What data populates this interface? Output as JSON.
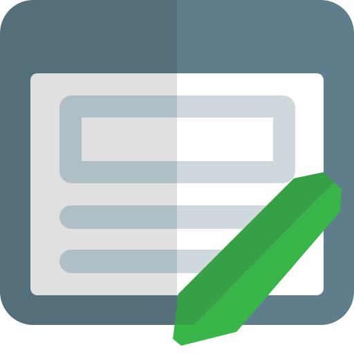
{
  "icon": {
    "name": "edit-page-icon",
    "colors": {
      "frame_dark": "#546e7a",
      "frame_light": "#607d8b",
      "paper_left": "#e0e0e0",
      "paper_right": "#ffffff",
      "block_left": "#b0bec5",
      "block_right": "#cfd8dc",
      "line_left": "#b0bec5",
      "line_right": "#cfd8dc",
      "pencil_dark": "#35a045",
      "pencil_light": "#3ab54a"
    }
  }
}
